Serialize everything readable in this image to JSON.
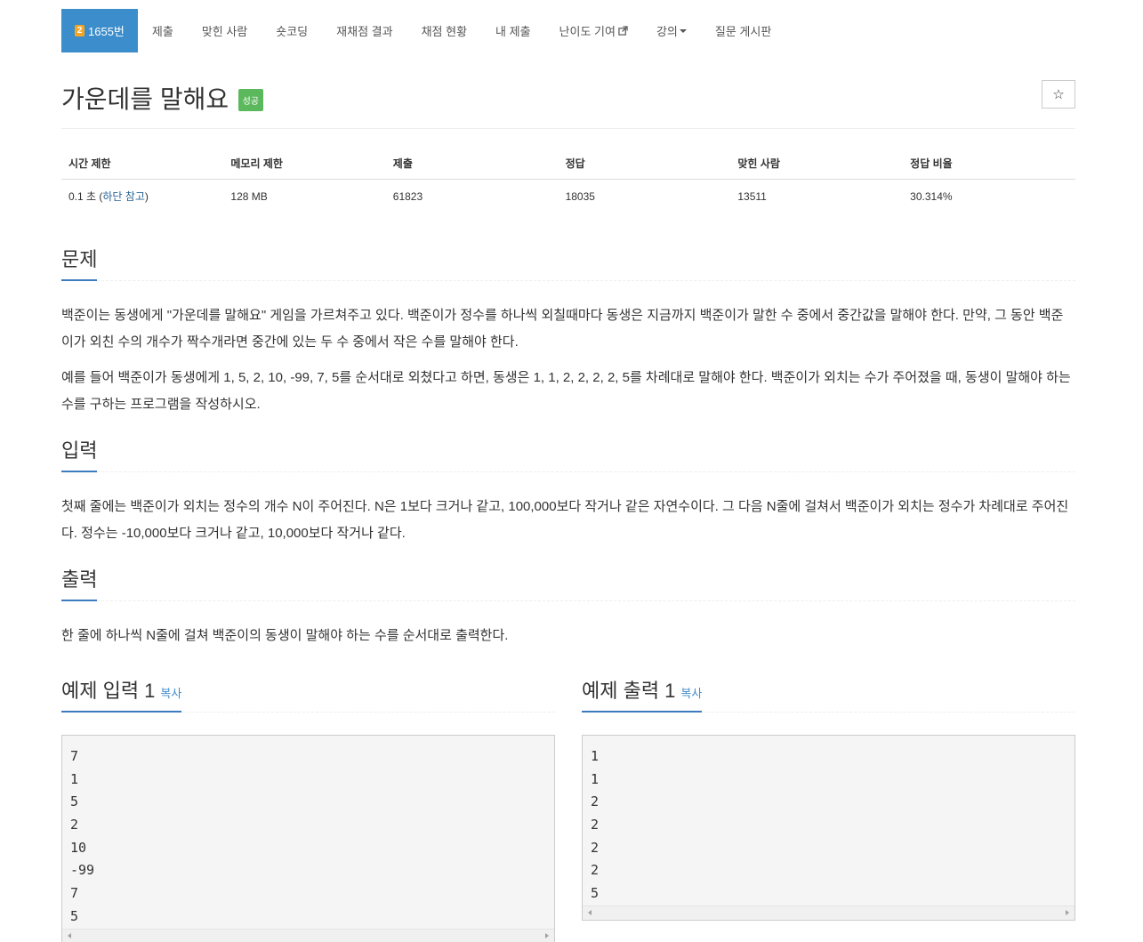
{
  "nav": {
    "problem_tab": {
      "tier_char": "2",
      "label": "1655번"
    },
    "items": [
      {
        "label": "제출"
      },
      {
        "label": "맞힌 사람"
      },
      {
        "label": "숏코딩"
      },
      {
        "label": "재채점 결과"
      },
      {
        "label": "채점 현황"
      },
      {
        "label": "내 제출"
      },
      {
        "label": "난이도 기여"
      },
      {
        "label": "강의"
      },
      {
        "label": "질문 게시판"
      }
    ]
  },
  "problem": {
    "title": "가운데를 말해요",
    "result_badge": "성공",
    "star_icon": "☆"
  },
  "info": {
    "headers": [
      "시간 제한",
      "메모리 제한",
      "제출",
      "정답",
      "맞힌 사람",
      "정답 비율"
    ],
    "time_limit_prefix": "0.1 초 (",
    "time_limit_link": "하단 참고",
    "time_limit_suffix": ")",
    "memory_limit": "128 MB",
    "submissions": "61823",
    "accepted": "18035",
    "solved_users": "13511",
    "ratio": "30.314%"
  },
  "sections": {
    "description": {
      "heading": "문제",
      "paragraphs": [
        "백준이는 동생에게 \"가운데를 말해요\" 게임을 가르쳐주고 있다. 백준이가 정수를 하나씩 외칠때마다 동생은 지금까지 백준이가 말한 수 중에서 중간값을 말해야 한다. 만약, 그 동안 백준이가 외친 수의 개수가 짝수개라면 중간에 있는 두 수 중에서 작은 수를 말해야 한다.",
        "예를 들어 백준이가 동생에게 1, 5, 2, 10, -99, 7, 5를 순서대로 외쳤다고 하면, 동생은 1, 1, 2, 2, 2, 2, 5를 차례대로 말해야 한다. 백준이가 외치는 수가 주어졌을 때, 동생이 말해야 하는 수를 구하는 프로그램을 작성하시오."
      ]
    },
    "input": {
      "heading": "입력",
      "paragraphs": [
        "첫째 줄에는 백준이가 외치는 정수의 개수 N이 주어진다. N은 1보다 크거나 같고, 100,000보다 작거나 같은 자연수이다. 그 다음 N줄에 걸쳐서 백준이가 외치는 정수가 차례대로 주어진다. 정수는 -10,000보다 크거나 같고, 10,000보다 작거나 같다."
      ]
    },
    "output": {
      "heading": "출력",
      "paragraphs": [
        "한 줄에 하나씩 N줄에 걸쳐 백준이의 동생이 말해야 하는 수를 순서대로 출력한다."
      ]
    }
  },
  "samples": {
    "input": {
      "heading": "예제 입력 1",
      "copy": "복사",
      "lines": [
        "7",
        "1",
        "5",
        "2",
        "10",
        "-99",
        "7",
        "5"
      ]
    },
    "output": {
      "heading": "예제 출력 1",
      "copy": "복사",
      "lines": [
        "1",
        "1",
        "2",
        "2",
        "2",
        "2",
        "5"
      ]
    }
  }
}
